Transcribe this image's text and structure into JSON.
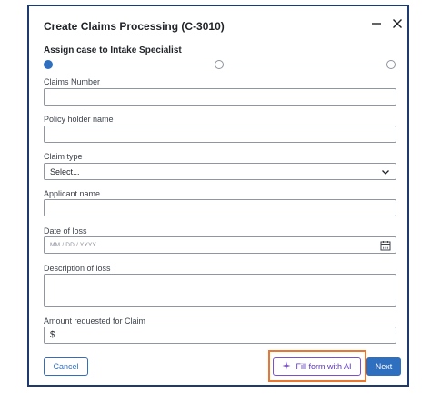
{
  "dialog": {
    "title": "Create Claims Processing (C-3010)",
    "minimize_icon": "minimize-icon",
    "close_icon": "close-icon"
  },
  "step": {
    "label": "Assign case to Intake Specialist",
    "total": 3,
    "current": 1
  },
  "form": {
    "claims_number": {
      "label": "Claims Number",
      "value": ""
    },
    "policy_holder": {
      "label": "Policy holder name",
      "value": ""
    },
    "claim_type": {
      "label": "Claim type",
      "value": "Select..."
    },
    "applicant_name": {
      "label": "Applicant name",
      "value": ""
    },
    "date_of_loss": {
      "label": "Date of loss",
      "placeholder": "MM / DD / YYYY",
      "icon": "calendar-icon"
    },
    "description": {
      "label": "Description of loss",
      "value": ""
    },
    "amount": {
      "label": "Amount requested for Claim",
      "prefix": "$"
    }
  },
  "footer": {
    "cancel_label": "Cancel",
    "ai_label": "Fill form with AI",
    "ai_icon": "sparkle-icon",
    "next_label": "Next"
  },
  "colors": {
    "accent": "#2f6fbf",
    "ai_accent": "#7b4fd0",
    "highlight": "#e8782f",
    "frame": "#1e3a6e"
  }
}
